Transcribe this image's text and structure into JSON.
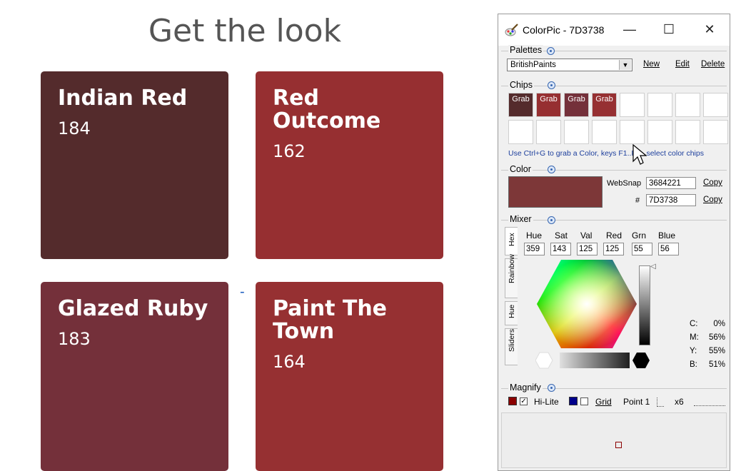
{
  "page": {
    "title": "Get the look",
    "tiles": [
      {
        "name": "Indian Red",
        "number": "184",
        "color": "#542b2c"
      },
      {
        "name": "Red Outcome",
        "number": "162",
        "color": "#962f31"
      },
      {
        "name": "Glazed Ruby",
        "number": "183",
        "color": "#74303a"
      },
      {
        "name": "Paint The Town",
        "number": "164",
        "color": "#963032"
      }
    ],
    "separator": "-"
  },
  "window": {
    "title": "ColorPic - 7D3738",
    "minimize": "—",
    "maximize": "☐",
    "close": "✕"
  },
  "palettes": {
    "label": "Palettes",
    "selected": "BritishPaints",
    "new_label": "New",
    "edit_label": "Edit",
    "delete_label": "Delete"
  },
  "chips": {
    "label": "Chips",
    "grab_label": "Grab",
    "filled": [
      {
        "color": "#542b2c"
      },
      {
        "color": "#962f31"
      },
      {
        "color": "#74303a"
      },
      {
        "color": "#963032"
      }
    ],
    "hint": "Use Ctrl+G to grab a Color, keys F1..F2.. select color chips"
  },
  "color": {
    "label": "Color",
    "value_color": "#7d3738",
    "websnap_label": "WebSnap",
    "websnap_value": "3684221",
    "hash_label": "#",
    "hex_value": "7D3738",
    "copy_label": "Copy"
  },
  "mixer": {
    "label": "Mixer",
    "tabs": [
      "Hex",
      "Rainbow",
      "Hue",
      "Sliders"
    ],
    "headers": [
      "Hue",
      "Sat",
      "Val",
      "Red",
      "Grn",
      "Blue"
    ],
    "values": [
      "359",
      "143",
      "125",
      "125",
      "55",
      "56"
    ],
    "cmyk": [
      {
        "k": "C:",
        "v": "0%"
      },
      {
        "k": "M:",
        "v": "56%"
      },
      {
        "k": "Y:",
        "v": "55%"
      },
      {
        "k": "B:",
        "v": "51%"
      }
    ]
  },
  "magnify": {
    "label": "Magnify",
    "hilite_label": "Hi-Lite",
    "grid_label": "Grid",
    "point_label": "Point 1",
    "zoom_label": "x6",
    "hilite_color": "#8b0000",
    "grid_color": "#00008b"
  }
}
